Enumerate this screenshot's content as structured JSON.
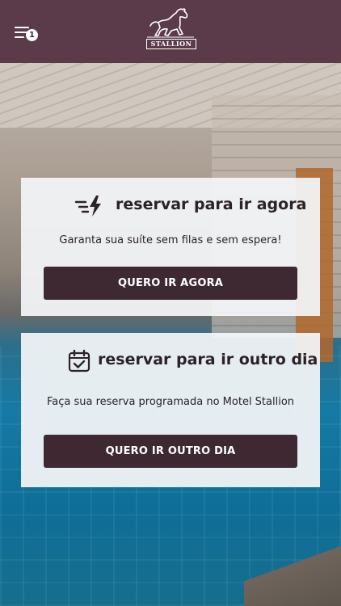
{
  "header": {
    "menu_icon": "menu-lines-icon",
    "notification_count": "1",
    "logo_text": "STALLION",
    "background_color": "#5b3b4a"
  },
  "cards": [
    {
      "icon": "fast-lightning-icon",
      "title": "reservar para ir agora",
      "subtitle": "Garanta sua suíte sem filas e sem espera!",
      "button_label": "QUERO IR AGORA"
    },
    {
      "icon": "calendar-check-icon",
      "title": "reservar para ir outro dia",
      "subtitle": "Faça sua reserva programada no Motel Stallion",
      "button_label": "QUERO IR OUTRO DIA"
    }
  ],
  "colors": {
    "button": "#3e2933",
    "card": "#f2f4f6",
    "text": "#2b2228"
  }
}
